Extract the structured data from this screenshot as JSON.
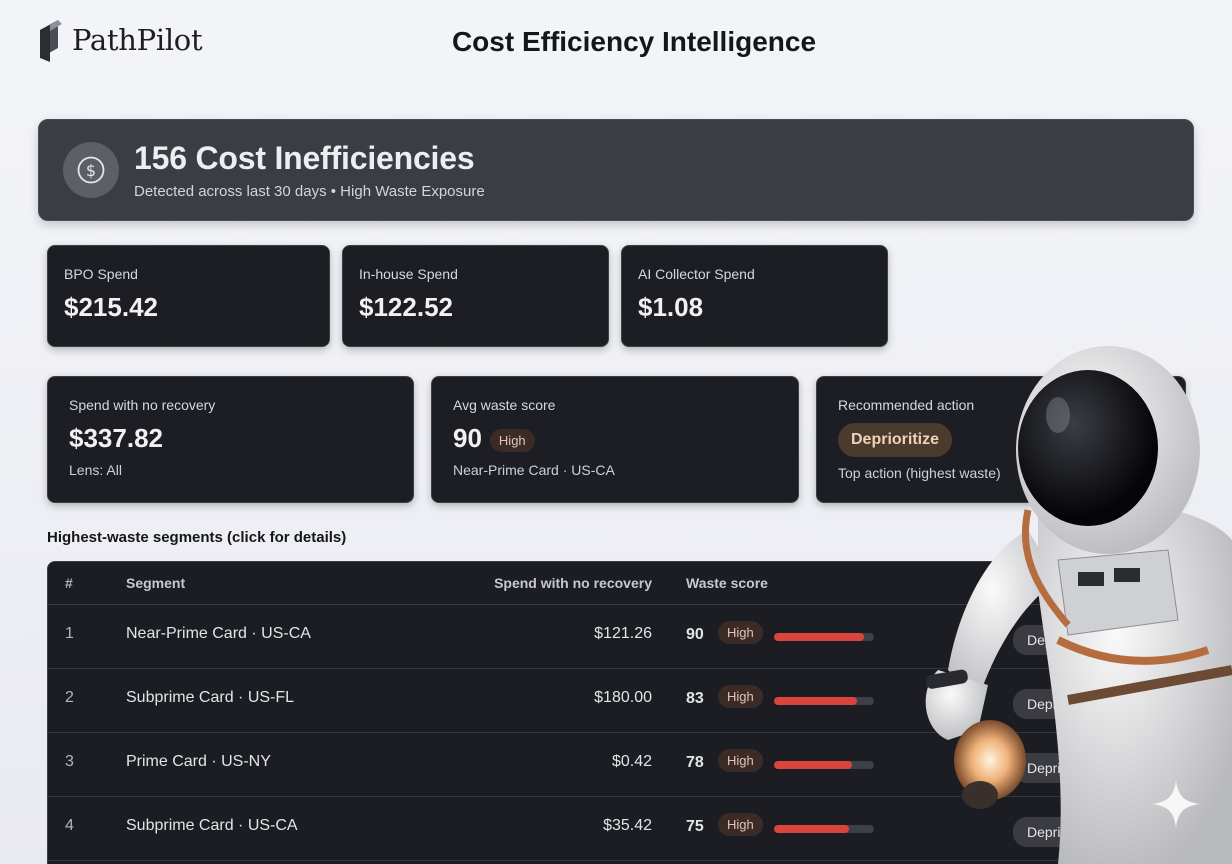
{
  "brand": {
    "name": "PathPilot"
  },
  "page": {
    "title": "Cost Efficiency Intelligence"
  },
  "banner": {
    "title": "156 Cost Inefficiencies",
    "subtitle": "Detected across last 30 days • High Waste Exposure",
    "icon": "dollar-circle-icon"
  },
  "spend_cards": [
    {
      "label": "BPO Spend",
      "value": "$215.42"
    },
    {
      "label": "In-house Spend",
      "value": "$122.52"
    },
    {
      "label": "AI Collector Spend",
      "value": "$1.08"
    }
  ],
  "summary": {
    "no_recovery": {
      "label": "Spend with no recovery",
      "value": "$337.82",
      "sub": "Lens: All"
    },
    "waste": {
      "label": "Avg waste score",
      "value": "90",
      "badge": "High",
      "sub": "Near-Prime Card · US-CA"
    },
    "action": {
      "label": "Recommended action",
      "button": "Deprioritize",
      "sub": "Top action (highest waste)"
    }
  },
  "segments_table": {
    "title": "Highest-waste segments (click for details)",
    "columns": [
      "#",
      "Segment",
      "Spend with no recovery",
      "Waste score"
    ],
    "rows": [
      {
        "num": "1",
        "segment": "Near-Prime Card · US-CA",
        "spend": "$121.26",
        "score": "90",
        "badge": "High",
        "level": 0.9,
        "action": "Depri"
      },
      {
        "num": "2",
        "segment": "Subprime Card · US-FL",
        "spend": "$180.00",
        "score": "83",
        "badge": "High",
        "level": 0.83,
        "action": "Deprio"
      },
      {
        "num": "3",
        "segment": "Prime Card · US-NY",
        "spend": "$0.42",
        "score": "78",
        "badge": "High",
        "level": 0.78,
        "action": "Deprio"
      },
      {
        "num": "4",
        "segment": "Subprime Card · US-CA",
        "spend": "$35.42",
        "score": "75",
        "badge": "High",
        "level": 0.75,
        "action": "Deprio"
      }
    ]
  },
  "colors": {
    "card_bg": "#1d1e24",
    "banner_bg": "#3a3d44",
    "bar_fill": "#d9443f",
    "badge_high_bg": "#3a2b27"
  }
}
